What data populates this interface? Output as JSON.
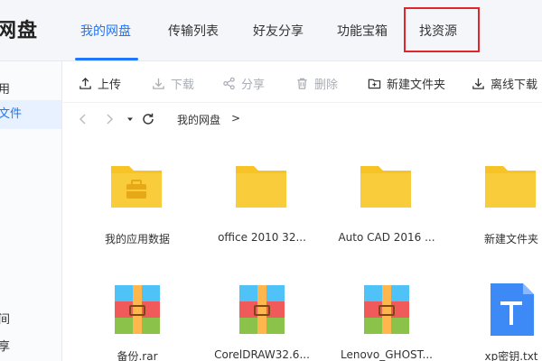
{
  "app": {
    "brand_text": "网盘"
  },
  "nav": {
    "tabs": [
      {
        "label": "我的网盘",
        "active": true
      },
      {
        "label": "传输列表",
        "active": false
      },
      {
        "label": "好友分享",
        "active": false
      },
      {
        "label": "功能宝箱",
        "active": false
      },
      {
        "label": "找资源",
        "active": false,
        "highlighted": true
      }
    ]
  },
  "sidebar": {
    "items": [
      {
        "label": "用",
        "active": false
      },
      {
        "label": "文件",
        "active": true
      },
      {
        "label": "间",
        "active": false
      },
      {
        "label": "享",
        "active": false
      }
    ]
  },
  "toolbar": {
    "upload": {
      "label": "上传",
      "icon": "upload-icon",
      "enabled": true
    },
    "download": {
      "label": "下载",
      "icon": "download-icon",
      "enabled": false
    },
    "share": {
      "label": "分享",
      "icon": "share-icon",
      "enabled": false
    },
    "delete": {
      "label": "删除",
      "icon": "trash-icon",
      "enabled": false
    },
    "new_folder": {
      "label": "新建文件夹",
      "icon": "new-folder-icon",
      "enabled": true
    },
    "offline_download": {
      "label": "离线下载",
      "icon": "download-icon",
      "enabled": true
    }
  },
  "breadcrumb": {
    "root": "我的网盘",
    "separator": ">"
  },
  "files": [
    {
      "name": "我的应用数据",
      "type": "app-folder"
    },
    {
      "name": "office 2010 32...",
      "type": "folder"
    },
    {
      "name": "Auto CAD 2016 ...",
      "type": "folder"
    },
    {
      "name": "新建文件夹",
      "type": "folder"
    },
    {
      "name": "备份.rar",
      "type": "rar"
    },
    {
      "name": "CorelDRAW32.6...",
      "type": "rar"
    },
    {
      "name": "Lenovo_GHOST...",
      "type": "rar"
    },
    {
      "name": "xp密钥.txt",
      "type": "txt"
    }
  ],
  "colors": {
    "accent": "#1f76ff",
    "highlight_border": "#e0252d",
    "folder": "#f7c325",
    "txt_icon": "#3d8af7"
  }
}
